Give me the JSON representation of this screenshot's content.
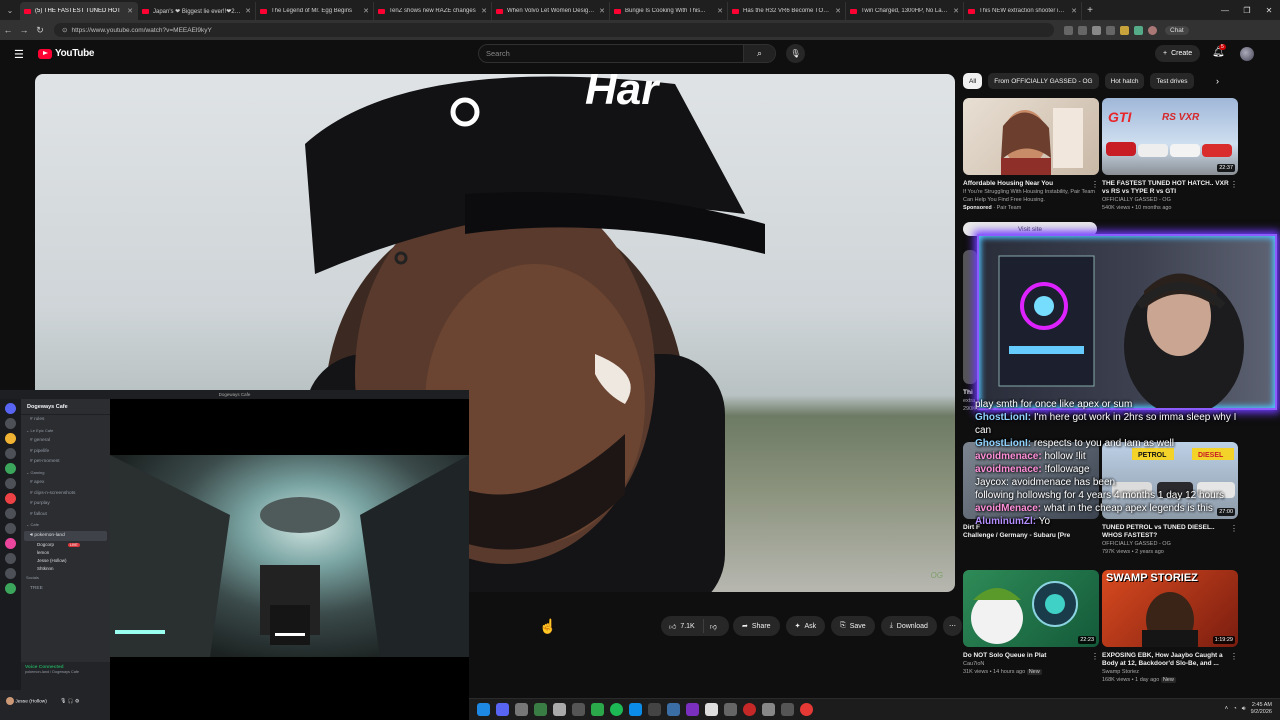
{
  "browser": {
    "tabs": [
      {
        "title": "(5) THE FASTEST TUNED HOT",
        "active": true
      },
      {
        "title": "Japan's ❤ Biggest lie ever!!❤280 Hp"
      },
      {
        "title": "The Legend of Mr. Egg Begins"
      },
      {
        "title": "TenZ shows new RAZE changes"
      },
      {
        "title": "When Volvo Let Women Design a"
      },
      {
        "title": "Bungie Is Cooking With This..."
      },
      {
        "title": "Has the R32 VR6 Become TOO Co"
      },
      {
        "title": "Twin Charged, 1300HP, No Lag. -"
      },
      {
        "title": "This NEW extraction shooter is W"
      }
    ],
    "url": "https://www.youtube.com/watch?v=MEEAEl9kyY",
    "chat_button": "Chat"
  },
  "youtube": {
    "logo_text": "YouTube",
    "search_placeholder": "Search",
    "create_label": "Create",
    "notif_count": "5",
    "actions": {
      "likes": "7.1K",
      "share": "Share",
      "ask": "Ask",
      "save": "Save",
      "download": "Download"
    },
    "chips": [
      "All",
      "From OFFICIALLY GASSED - OG",
      "Hot hatch",
      "Test drives"
    ],
    "ad": {
      "title": "Affordable Housing Near You",
      "desc": "If You're Struggling With Housing Instability, Pair Team Can Help You Find Free Housing.",
      "sponsored": "Sponsored",
      "advertiser": "Pair Team",
      "visit": "Visit site"
    },
    "rec1": {
      "title": "THE FASTEST TUNED HOT HATCH.. VXR vs RS vs TYPE R vs GTI",
      "channel": "OFFICIALLY GASSED - OG",
      "meta": "540K views • 10 months ago",
      "duration": "22:37"
    },
    "rec2": {
      "title_a": "Dirt F",
      "title_b": "Challenge / Germany - Subaru [Pre",
      "title_c": "Thi",
      "title_d": "extra"
    },
    "rec3": {
      "title": "TUNED PETROL vs TUNED DIESEL.. WHOS FASTEST?",
      "channel": "OFFICIALLY GASSED - OG",
      "meta": "797K views • 2 years ago",
      "duration": "27:00"
    },
    "rec4": {
      "title": "Do NOT Solo Queue in Plat",
      "channel": "Cau7ioN",
      "meta": "31K views • 14 hours ago",
      "badge": "New",
      "duration": "22:23"
    },
    "rec5": {
      "title": "EXPOSING EBK, How Jaaybo Caught a Body at 12, Backdoor'd Slo-Be, and ...",
      "channel": "Swamp Storiez",
      "meta": "168K views • 1 day ago",
      "badge": "New",
      "duration": "1:19:29",
      "thumb_text": "SWAMP STORIEZ"
    },
    "views_stub": "290K"
  },
  "stream_chat": [
    {
      "user": "",
      "msg": "play smth for once like apex or sum",
      "color": "#ffffff"
    },
    {
      "user": "GhostLionI:",
      "msg": "I'm here got work in 2hrs so imma sleep why I",
      "color": "#8fd3ff"
    },
    {
      "user": "",
      "msg": "can",
      "color": "#ffffff"
    },
    {
      "user": "GhostLionI:",
      "msg": "respects to you and Iam as well",
      "color": "#8fd3ff"
    },
    {
      "user": "avoidmenace:",
      "msg": "hollow !lit",
      "color": "#ff8fd8"
    },
    {
      "user": "avoidmenace:",
      "msg": "!followage",
      "color": "#ff8fd8"
    },
    {
      "user": "",
      "msg": "Jaycox: avoidmenace has been",
      "color": "#ffffff"
    },
    {
      "user": "",
      "msg": "following hollowshg for 4 years 4 months 1 day 12 hours",
      "color": "#ffffff"
    },
    {
      "user": "avoidMenace:",
      "msg": "what in the cheap apex legends is this",
      "color": "#ff8fd8"
    },
    {
      "user": "AluminumZl:",
      "msg": "Yo",
      "color": "#b58fff"
    }
  ],
  "discord": {
    "window_title": "Dogeways Cafe",
    "guild": "Dogeways Cafe",
    "channels": [
      {
        "name": "rules",
        "type": "text"
      },
      {
        "name": "Le Epic Cafe",
        "type": "cat"
      },
      {
        "name": "general",
        "type": "text"
      },
      {
        "name": "pipelife",
        "type": "text"
      },
      {
        "name": "pet-moment",
        "type": "text"
      },
      {
        "name": "Gaming",
        "type": "cat"
      },
      {
        "name": "apex",
        "type": "text"
      },
      {
        "name": "clips-n-screenshots",
        "type": "text"
      },
      {
        "name": "purplay",
        "type": "text"
      },
      {
        "name": "fallout",
        "type": "text"
      },
      {
        "name": "Cafe",
        "type": "cat"
      },
      {
        "name": "pokemon-land",
        "type": "voice-on"
      }
    ],
    "voice_users": [
      "Dogcorp",
      "lemon",
      "Jesse (Hollow)",
      "Shtknnn"
    ],
    "live_label": "LIVE",
    "social_cat": "Socials",
    "social_ch": "TREE",
    "voice_status": "Voice Connected",
    "voice_sub": "pokemon-land / Dogeways Cafe",
    "user": "Jesse (Hollow)"
  },
  "taskbar": {
    "time": "2:45 AM",
    "date": "9/2/2026"
  }
}
